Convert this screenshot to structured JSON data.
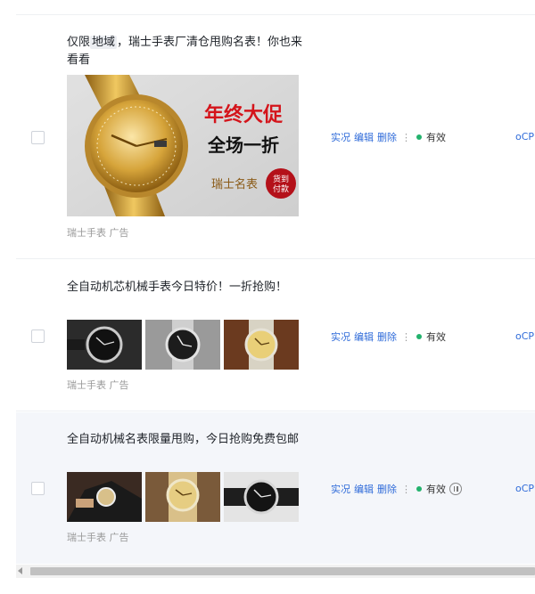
{
  "rows": [
    {
      "title_prefix": "仅限",
      "title_keyword": "地域",
      "title_suffix": "，瑞士手表厂清仓甩购名表！你也来看看",
      "creative": {
        "headline_1": "年终大促",
        "headline_2": "全场一折",
        "brand": "瑞士名表",
        "badge": "货到付款"
      },
      "caption": "瑞士手表 广告",
      "ops": {
        "live": "实况",
        "edit": "编辑",
        "delete": "删除",
        "more": "⋮"
      },
      "status": "有效",
      "bid": "oCP"
    },
    {
      "title": "全自动机芯机械手表今日特价！一折抢购！",
      "caption": "瑞士手表 广告",
      "ops": {
        "live": "实况",
        "edit": "编辑",
        "delete": "删除",
        "more": "⋮"
      },
      "status": "有效",
      "bid": "oCP"
    },
    {
      "title": "全自动机械名表限量甩购，今日抢购免费包邮",
      "caption": "瑞士手表 广告",
      "ops": {
        "live": "实况",
        "edit": "编辑",
        "delete": "删除",
        "more": "⋮"
      },
      "status": "有效",
      "bid": "oCP"
    }
  ],
  "colors": {
    "link": "#2f6bd9",
    "status_active": "#23b26d",
    "creative_red": "#d4141b",
    "row_hover": "#f4f6fa"
  },
  "icons": {
    "more": "vertical-ellipsis",
    "status": "green-dot",
    "pause": "pause-circle",
    "scroll": "triangle-left"
  }
}
